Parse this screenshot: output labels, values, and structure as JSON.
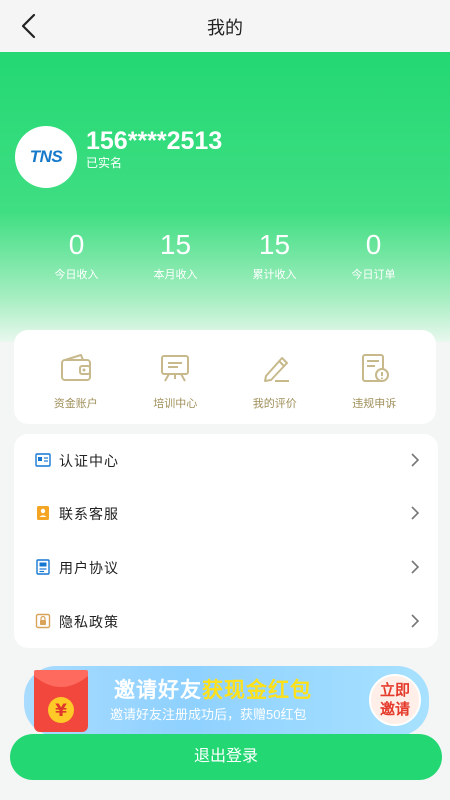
{
  "header": {
    "title": "我的"
  },
  "profile": {
    "avatar_text": "TNS",
    "phone": "156****2513",
    "verify_status": "已实名"
  },
  "stats": [
    {
      "value": "0",
      "label": "今日收入"
    },
    {
      "value": "15",
      "label": "本月收入"
    },
    {
      "value": "15",
      "label": "累计收入"
    },
    {
      "value": "0",
      "label": "今日订单"
    }
  ],
  "tools": [
    {
      "label": "资金账户",
      "icon": "wallet-icon"
    },
    {
      "label": "培训中心",
      "icon": "training-board-icon"
    },
    {
      "label": "我的评价",
      "icon": "pen-icon"
    },
    {
      "label": "违规申诉",
      "icon": "document-alert-icon"
    }
  ],
  "menu": [
    {
      "label": "认证中心",
      "icon": "id-card-icon"
    },
    {
      "label": "联系客服",
      "icon": "customer-service-icon"
    },
    {
      "label": "用户协议",
      "icon": "agreement-icon"
    },
    {
      "label": "隐私政策",
      "icon": "privacy-icon"
    }
  ],
  "banner": {
    "title_plain": "邀请好友",
    "title_highlight": "获现金红包",
    "subtitle": "邀请好友注册成功后，获赠50红包",
    "button_line1": "立即",
    "button_line2": "邀请",
    "envelope_symbol": "¥"
  },
  "logout_label": "退出登录",
  "colors": {
    "primary": "#23d873",
    "tool_label": "#9f8f5a",
    "tool_icon": "#c7b98c",
    "menu_icon": "#1677d2"
  }
}
